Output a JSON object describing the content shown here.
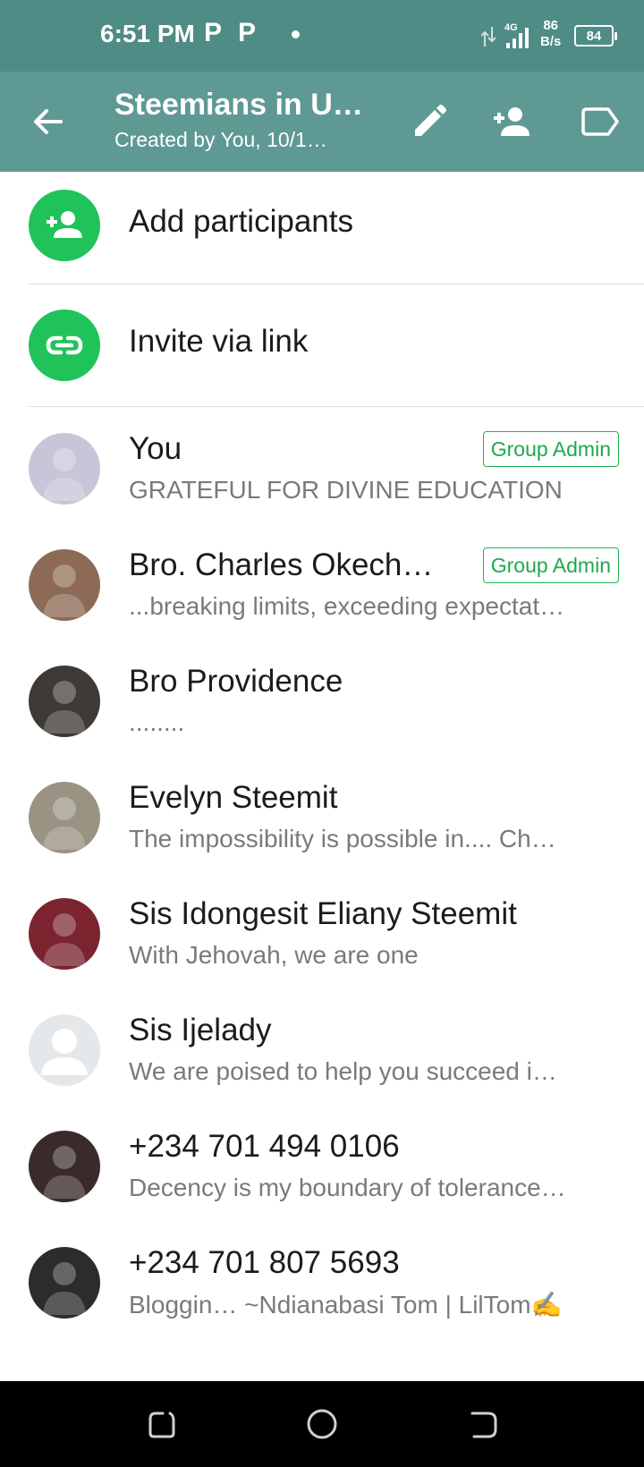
{
  "status": {
    "time": "6:51 PM",
    "notif1": "P",
    "notif2": "P",
    "network": "4G",
    "speed_value": "86",
    "speed_unit": "B/s",
    "battery": "84"
  },
  "header": {
    "title": "Steemians in U…",
    "subtitle": "Created by You, 10/1…"
  },
  "actions": [
    {
      "label": "Add participants",
      "icon": "add-person-icon"
    },
    {
      "label": "Invite via link",
      "icon": "link-icon"
    }
  ],
  "admin_badge": "Group Admin",
  "members": [
    {
      "name": "You",
      "about": "GRATEFUL FOR DIVINE EDUCATION",
      "admin": true,
      "avatar_color": "#c9c4d8"
    },
    {
      "name": "Bro. Charles Okech…",
      "about": "...breaking limits, exceeding expectat…",
      "admin": true,
      "avatar_color": "#8c6a55"
    },
    {
      "name": "Bro Providence",
      "about": "........",
      "admin": false,
      "avatar_color": "#3f3a35"
    },
    {
      "name": "Evelyn Steemit",
      "about": "The impossibility is possible in.... Ch…",
      "admin": false,
      "avatar_color": "#9a9383"
    },
    {
      "name": "Sis Idongesit Eliany Steemit",
      "about": "With Jehovah, we are one",
      "admin": false,
      "avatar_color": "#7b2430"
    },
    {
      "name": "Sis Ijelady",
      "about": "We are poised to help you succeed i…",
      "admin": false,
      "avatar_color": "#e4e8ea"
    },
    {
      "name": "+234 701 494 0106",
      "about": "Decency is my boundary of tolerance…",
      "admin": false,
      "avatar_color": "#3a2b2a"
    },
    {
      "name": "+234 701 807 5693",
      "about": "Bloggin… ~Ndianabasi Tom | LilTom✍️",
      "admin": false,
      "avatar_color": "#2c2c2c"
    }
  ],
  "colors": {
    "status_bar": "#4f8c85",
    "app_bar": "#5f9994",
    "accent_green": "#1fc35a",
    "admin_green": "#1fa84f"
  }
}
